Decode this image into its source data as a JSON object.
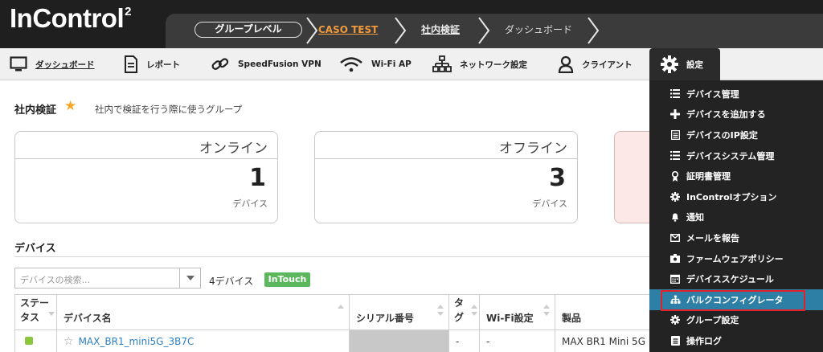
{
  "app": {
    "logo_text": "InControl",
    "logo_superscript": "2"
  },
  "breadcrumb": {
    "level": "グループレベル",
    "org": "CASO TEST",
    "group": "社内検証",
    "page": "ダッシュボード"
  },
  "nav": {
    "dashboard": "ダッシュボード",
    "reports": "レポート",
    "speedfusion": "SpeedFusion VPN",
    "wifi": "Wi-Fi AP",
    "network": "ネットワーク設定",
    "clients": "クライアント",
    "settings": "設定"
  },
  "group": {
    "name": "社内検証",
    "description": "社内で検証を行う際に使うグループ"
  },
  "cards": [
    {
      "title": "オンライン",
      "count": "1",
      "unit": "デバイス"
    },
    {
      "title": "オフライン",
      "count": "3",
      "unit": "デバイス"
    }
  ],
  "devices": {
    "section_title": "デバイス",
    "search_placeholder": "デバイスの検索...",
    "count_text": "4デバイス",
    "badge": "InTouch",
    "columns": [
      "ステータス",
      "デバイス名",
      "シリアル番号",
      "タグ",
      "Wi-Fi設定",
      "製品"
    ],
    "rows": [
      {
        "name": "MAX_BR1_mini5G_3B7C",
        "serial": "",
        "tag": "-",
        "wifi": "-",
        "product": "MAX BR1 Mini 5G"
      }
    ]
  },
  "settings_menu": {
    "items": [
      "デバイス管理",
      "デバイスを追加する",
      "デバイスのIP設定",
      "デバイスシステム管理",
      "証明書管理",
      "InControlオプション",
      "通知",
      "メールを報告",
      "ファームウェアポリシー",
      "デバイススケジュール",
      "バルクコンフィグレータ",
      "グループ設定",
      "操作ログ"
    ],
    "highlighted_index": 10
  },
  "colors": {
    "header_bg": "#1f1f1f",
    "breadcrumb_bg": "#3b3b3b",
    "org_link": "#f09a3c",
    "star": "#f5a623",
    "badge_green": "#5cb85c",
    "status_online": "#8dc63f",
    "menu_bg": "#232323",
    "menu_highlight": "#2e7fa6",
    "highlight_outline": "#e0232b",
    "link": "#2d7fc1"
  }
}
